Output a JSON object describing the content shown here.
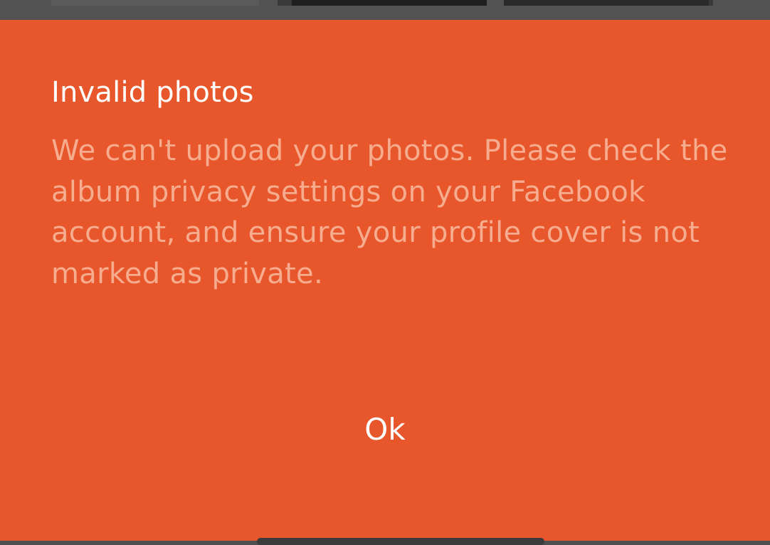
{
  "dialog": {
    "title": "Invalid photos",
    "message": "We can't upload your photos. Please check the album privacy settings on your Facebook account, and ensure your profile cover is not marked as private.",
    "ok_label": "Ok"
  },
  "colors": {
    "dialog_background": "#e8572b",
    "title_text": "#ffffff",
    "message_text": "#f6ac8f",
    "backdrop": "#525252"
  }
}
